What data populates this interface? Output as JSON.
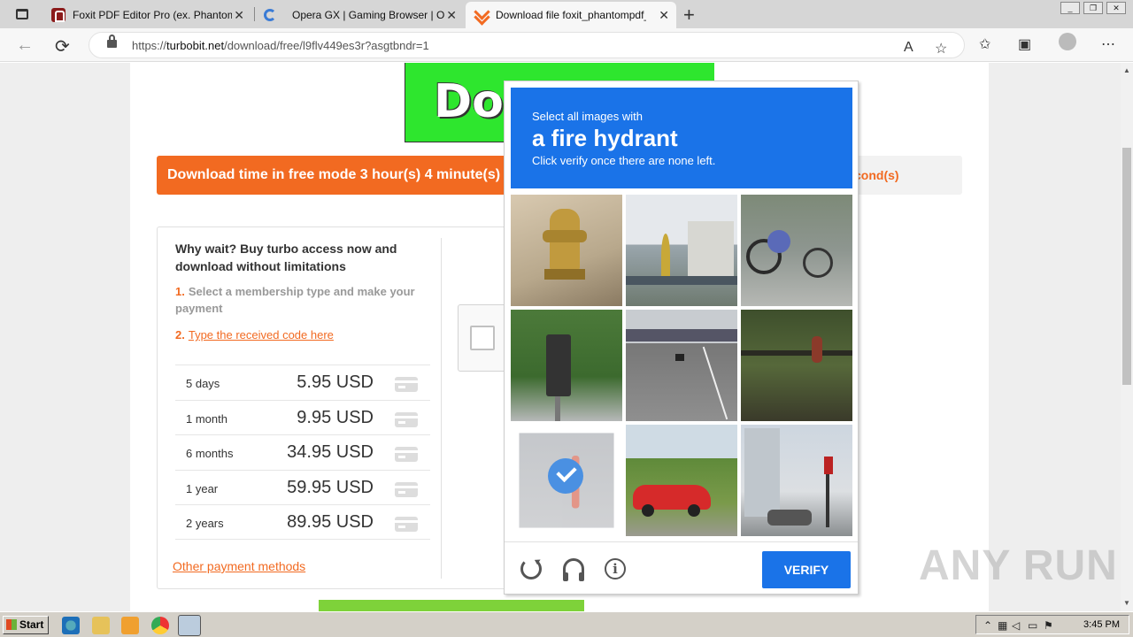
{
  "browser": {
    "tabs": [
      {
        "title": "Foxit PDF Editor Pro (ex. Phantom",
        "icon": "foxit-icon",
        "active": false
      },
      {
        "title": "Opera GX | Gaming Browser | Opera",
        "icon": "opera-icon",
        "active": false
      },
      {
        "title": "Download file foxit_phantompdf_",
        "icon": "turbobit-icon",
        "active": true
      }
    ],
    "close_glyph": "✕",
    "new_tab_glyph": "+",
    "url_prefix": "https://",
    "url_host": "turbobit.net",
    "url_path": "/download/free/l9flv449es3r?asgtbndr=1"
  },
  "page": {
    "banner_text": "Do",
    "download_time": "Download time in free mode 3 hour(s) 4 minute(s)",
    "wait_text": "cond(s)",
    "offer": {
      "title": "Why wait? Buy turbo access now and download without limitations",
      "step1_num": "1.",
      "step1_text": "Select a membership type and make your payment",
      "step2_num": "2.",
      "step2_link": "Type the received code here",
      "prices": [
        {
          "period": "5 days",
          "price": "5.95 USD"
        },
        {
          "period": "1 month",
          "price": "9.95 USD"
        },
        {
          "period": "6 months",
          "price": "34.95 USD"
        },
        {
          "period": "1 year",
          "price": "59.95 USD"
        },
        {
          "period": "2 years",
          "price": "89.95 USD"
        }
      ],
      "other_methods": "Other payment methods"
    }
  },
  "captcha": {
    "line1": "Select all images with",
    "line2": "a fire hydrant",
    "line3": "Click verify once there are none left.",
    "tiles": [
      {
        "content": "fire hydrant",
        "selected": false
      },
      {
        "content": "building",
        "selected": false
      },
      {
        "content": "bicycles",
        "selected": false
      },
      {
        "content": "traffic light",
        "selected": false
      },
      {
        "content": "highway",
        "selected": false
      },
      {
        "content": "park",
        "selected": false
      },
      {
        "content": "fire hydrant",
        "selected": true
      },
      {
        "content": "red car",
        "selected": false
      },
      {
        "content": "street building",
        "selected": false
      }
    ],
    "verify_label": "VERIFY",
    "info_glyph": "i",
    "accent": "#1a73e8"
  },
  "watermark": "ANY RUN",
  "taskbar": {
    "start_label": "Start",
    "clock": "3:45 PM"
  }
}
